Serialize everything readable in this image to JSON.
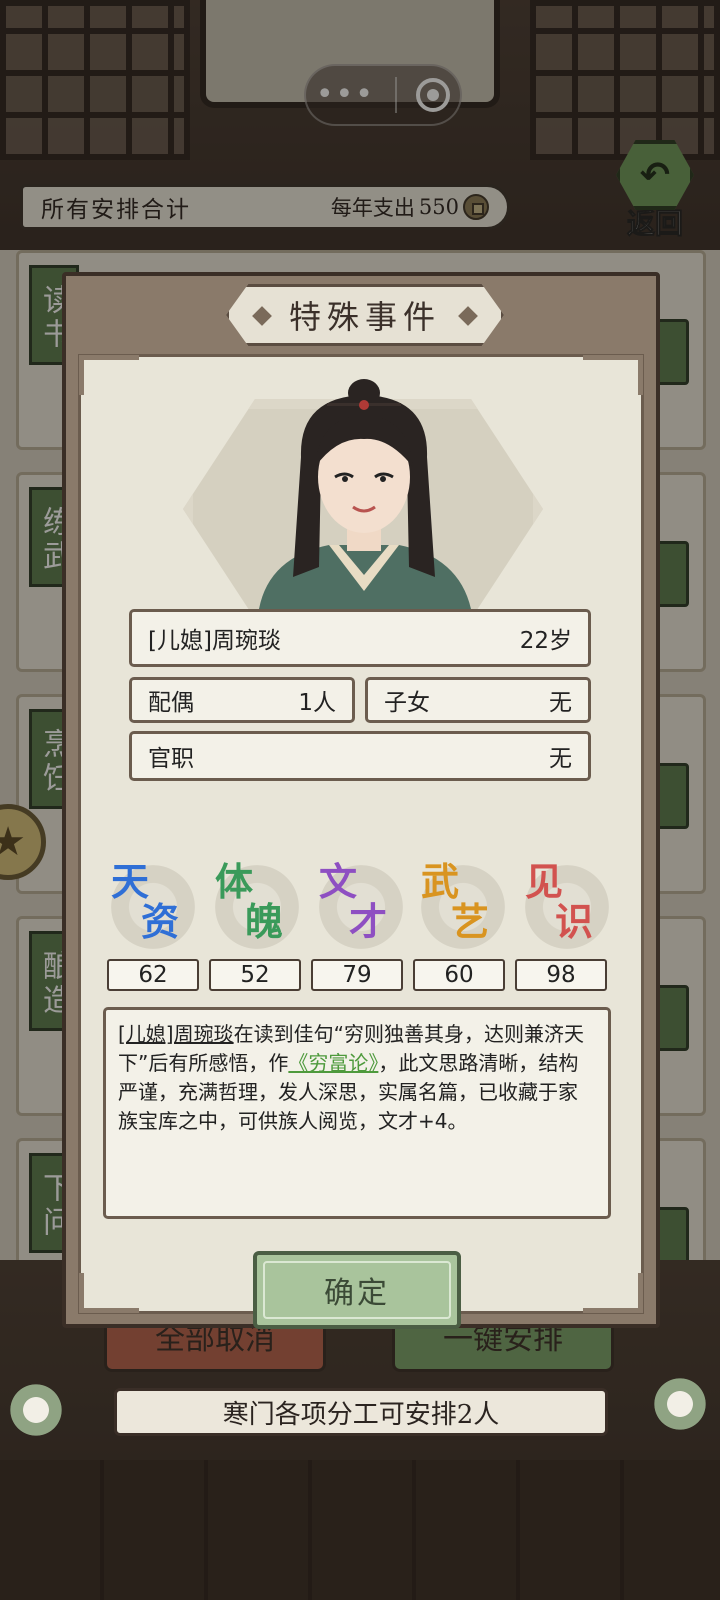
{
  "summary_bar": {
    "title": "所有安排合计",
    "annual_label": "每年支出",
    "annual_value": "550"
  },
  "back_button": {
    "label": "返回"
  },
  "background_tags": [
    "读书",
    "练武",
    "烹饪",
    "酿造",
    "下问"
  ],
  "bottom": {
    "cancel_all": "全部取消",
    "one_click": "一键安排",
    "note": "寒门各项分工可安排2人"
  },
  "dialog": {
    "title": "特殊事件",
    "character": {
      "name": "[儿媳]周琬琰",
      "age": "22岁",
      "spouse_label": "配偶",
      "spouse_value": "1人",
      "children_label": "子女",
      "children_value": "无",
      "office_label": "官职",
      "office_value": "无"
    },
    "stats": [
      {
        "name": "天资",
        "c1": "天",
        "c2": "资",
        "value": "62",
        "color": "#2f6fd6"
      },
      {
        "name": "体魄",
        "c1": "体",
        "c2": "魄",
        "value": "52",
        "color": "#3a9a5a"
      },
      {
        "name": "文才",
        "c1": "文",
        "c2": "才",
        "value": "79",
        "color": "#8e4fc2"
      },
      {
        "name": "武艺",
        "c1": "武",
        "c2": "艺",
        "value": "60",
        "color": "#d99420"
      },
      {
        "name": "见识",
        "c1": "见",
        "c2": "识",
        "value": "98",
        "color": "#d2524f"
      }
    ],
    "description": {
      "subject": "[儿媳]周琬琰",
      "part1": "在读到佳句“穷则独善其身，达则兼济天下”后有所感悟，作",
      "work": "《穷富论》",
      "part2": "，此文思路清晰，结构严谨，充满哲理，发人深思，实属名篇，已收藏于家族宝库之中，可供族人阅览，文才+4。"
    },
    "confirm": "确定"
  }
}
